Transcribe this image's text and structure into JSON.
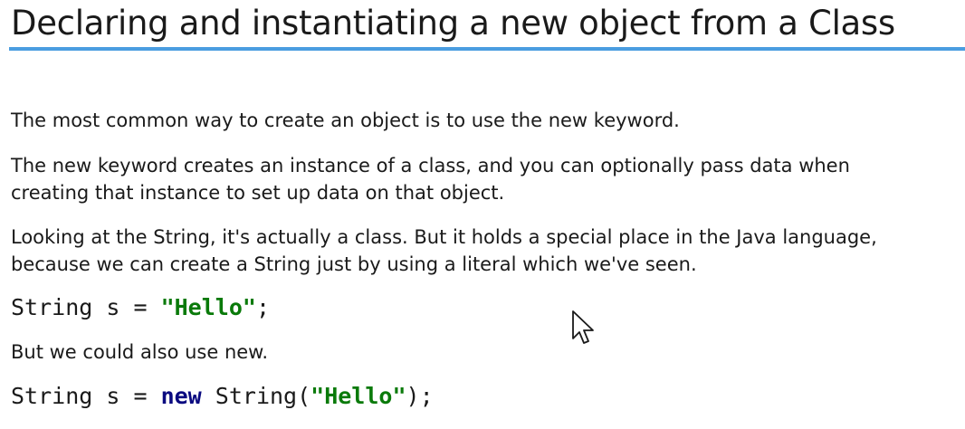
{
  "slide": {
    "title": "Declaring and instantiating a new object from a Class",
    "paragraphs": [
      "The most common way to create an object is to use the new keyword.",
      [
        "The new keyword creates an instance of a class, and you can optionally pass data when",
        "creating that instance to set up data on that object."
      ],
      [
        "Looking at the String, it's actually a class. But it holds a special place in the Java language,",
        "because we can create a String just by using a literal which we've seen."
      ],
      "But we could also use new."
    ],
    "code_1": {
      "prefix": "String s = ",
      "string_literal": "\"Hello\"",
      "suffix": ";"
    },
    "code_2": {
      "prefix": "String s = ",
      "keyword": "new",
      "middle": " String(",
      "string_literal": "\"Hello\"",
      "suffix": ");"
    },
    "colors": {
      "title_rule": "#4a9de0",
      "string_literal": "#0a7a0a",
      "keyword": "#0a0a80",
      "text": "#1a1a1a"
    },
    "cursor_icon": "mouse-pointer-icon"
  }
}
